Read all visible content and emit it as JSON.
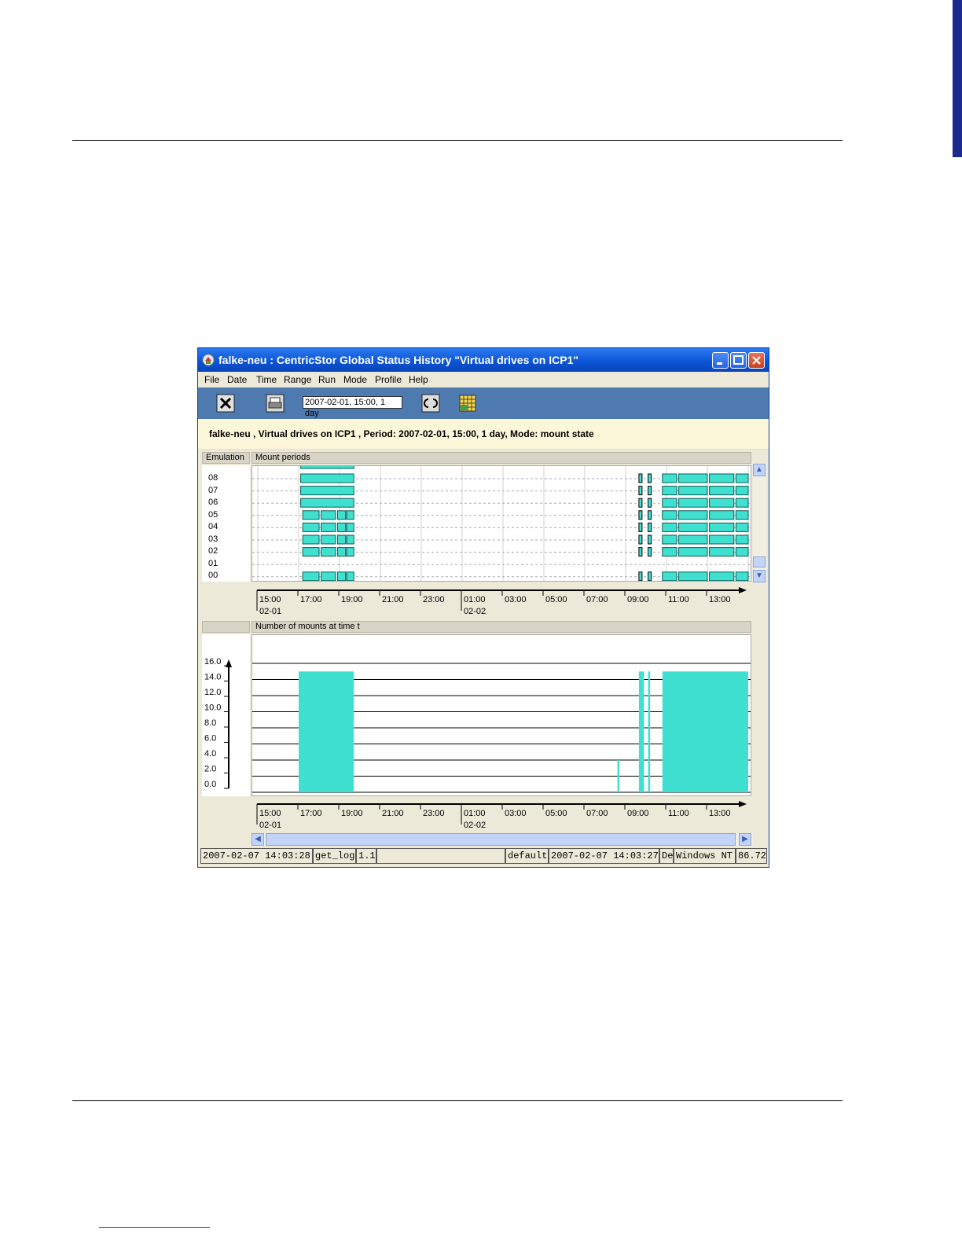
{
  "window": {
    "title": "falke-neu : CentricStor Global Status History \"Virtual drives on ICP1\"",
    "controls": [
      "minimize",
      "maximize",
      "close"
    ]
  },
  "menu": [
    "File",
    "Date",
    "Time",
    "Range",
    "Run",
    "Mode",
    "Profile",
    "Help"
  ],
  "toolbar": {
    "period_value": "2007-02-01, 15:00, 1 day",
    "icons": [
      "close-x-icon",
      "print-icon",
      "refresh-icon",
      "grid-icon"
    ]
  },
  "header": {
    "text": "falke-neu , Virtual drives on ICP1 , Period: 2007-02-01, 15:00, 1 day, Mode: mount state"
  },
  "mount_panel": {
    "left_header": "Emulation",
    "right_header": "Mount periods",
    "rows": [
      "08",
      "07",
      "06",
      "05",
      "04",
      "03",
      "02",
      "01",
      "00"
    ]
  },
  "time_axis": {
    "ticks": [
      "15:00",
      "17:00",
      "19:00",
      "21:00",
      "23:00",
      "01:00",
      "03:00",
      "05:00",
      "07:00",
      "09:00",
      "11:00",
      "13:00"
    ],
    "dates": [
      "02-01",
      "02-02"
    ]
  },
  "count_panel": {
    "right_header": "Number of mounts at time t"
  },
  "chart_data": {
    "type": "area",
    "title": "Number of mounts at time t",
    "y_ticks": [
      "16.0",
      "14.0",
      "12.0",
      "10.0",
      "8.0",
      "6.0",
      "4.0",
      "2.0",
      "0.0"
    ],
    "ylim": [
      0,
      16
    ],
    "x_unit": "hours from 2007-02-01 15:00",
    "series": [
      {
        "segments": [
          {
            "start": 2.0,
            "end": 4.7,
            "value": 15
          },
          {
            "start": 17.6,
            "end": 17.7,
            "value": 4
          },
          {
            "start": 18.65,
            "end": 18.9,
            "value": 15
          },
          {
            "start": 19.1,
            "end": 19.2,
            "value": 15
          },
          {
            "start": 19.8,
            "end": 24.0,
            "value": 15
          }
        ]
      }
    ]
  },
  "statusbar": [
    "2007-02-07 14:03:28",
    "get_log",
    "1.1",
    "",
    "default",
    "2007-02-07 14:03:27",
    "De",
    "Windows NT",
    "86.72"
  ]
}
